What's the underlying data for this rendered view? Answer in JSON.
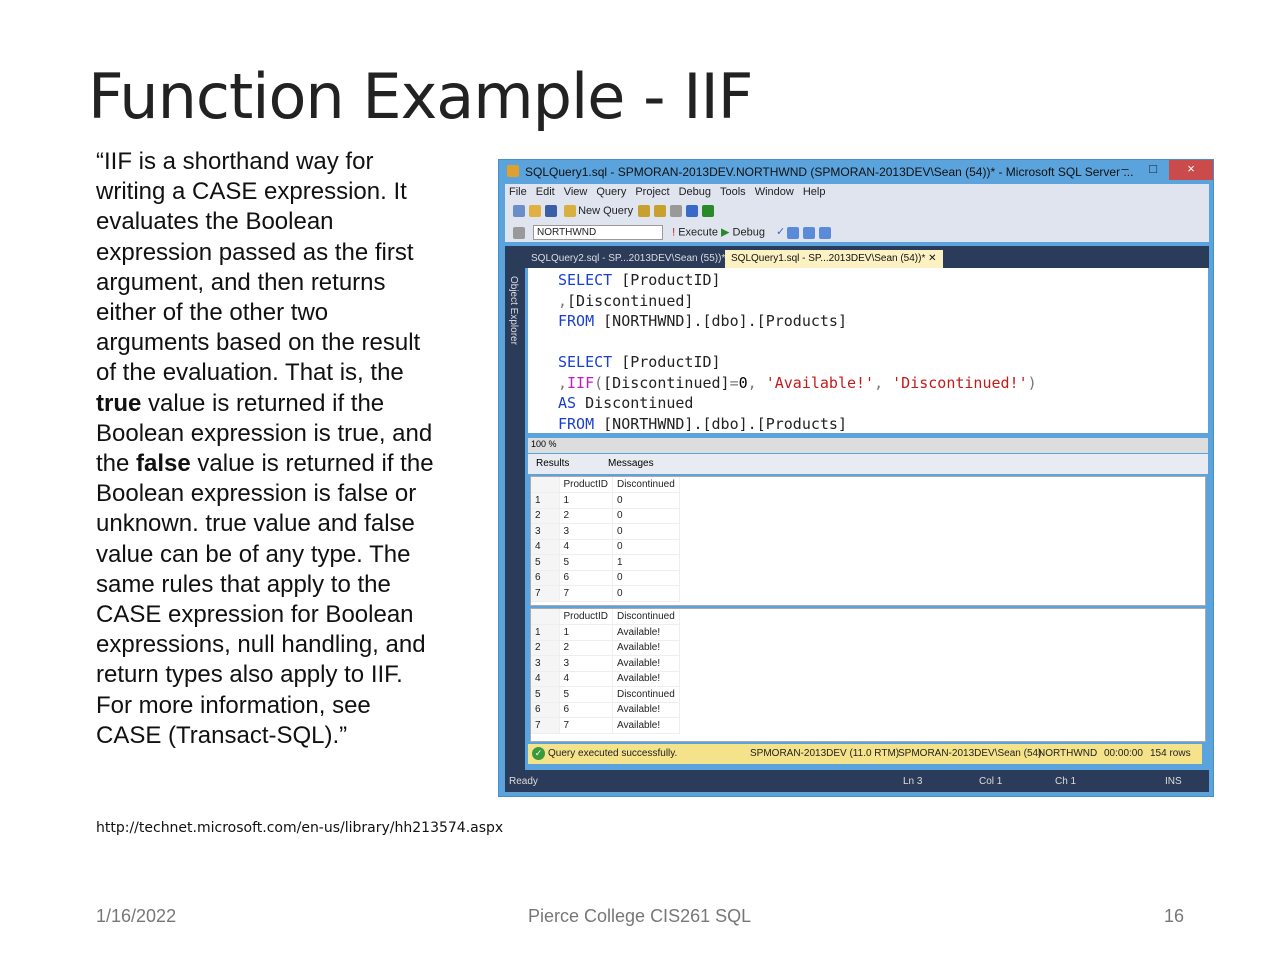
{
  "slide": {
    "title": "Function Example - IIF",
    "body_parts": [
      "“IIF is a shorthand way for writing a CASE expression. It evaluates the Boolean expression passed as the first argument, and then returns either of the other two arguments based on the result of the evaluation. That is, the ",
      "true",
      " value is returned if the Boolean expression is true, and the ",
      "false",
      " value is returned if the Boolean expression is false or unknown. true value and false value can be of any type. The same rules that apply to the CASE expression for Boolean expressions, null handling, and return types also apply to IIF. For more information, see CASE (Transact-SQL).”"
    ],
    "source": "http://technet.microsoft.com/en-us/library/hh213574.aspx",
    "date": "1/16/2022",
    "footer": "Pierce College CIS261 SQL",
    "page": "16"
  },
  "ssms": {
    "title": "SQLQuery1.sql - SPMORAN-2013DEV.NORTHWND (SPMORAN-2013DEV\\Sean (54))* - Microsoft SQL Server ...",
    "menu": [
      "File",
      "Edit",
      "View",
      "Query",
      "Project",
      "Debug",
      "Tools",
      "Window",
      "Help"
    ],
    "new_query": "New Query",
    "database": "NORTHWND",
    "execute": "Execute",
    "debug": "Debug",
    "object_explorer": "Object Explorer",
    "tabs": [
      "SQLQuery2.sql - SP...2013DEV\\Sean (55))*",
      "SQLQuery1.sql - SP...2013DEV\\Sean (54))*"
    ],
    "zoom": "100 %",
    "result_tabs": [
      "Results",
      "Messages"
    ],
    "grid1": {
      "headers": [
        "ProductID",
        "Discontinued"
      ],
      "rows": [
        [
          "1",
          "1",
          "0"
        ],
        [
          "2",
          "2",
          "0"
        ],
        [
          "3",
          "3",
          "0"
        ],
        [
          "4",
          "4",
          "0"
        ],
        [
          "5",
          "5",
          "1"
        ],
        [
          "6",
          "6",
          "0"
        ],
        [
          "7",
          "7",
          "0"
        ]
      ]
    },
    "grid2": {
      "headers": [
        "ProductID",
        "Discontinued"
      ],
      "rows": [
        [
          "1",
          "1",
          "Available!"
        ],
        [
          "2",
          "2",
          "Available!"
        ],
        [
          "3",
          "3",
          "Available!"
        ],
        [
          "4",
          "4",
          "Available!"
        ],
        [
          "5",
          "5",
          "Discontinued"
        ],
        [
          "6",
          "6",
          "Available!"
        ],
        [
          "7",
          "7",
          "Available!"
        ]
      ]
    },
    "status": {
      "message": "Query executed successfully.",
      "server": "SPMORAN-2013DEV (11.0 RTM)",
      "user": "SPMORAN-2013DEV\\Sean (54)",
      "db": "NORTHWND",
      "time": "00:00:00",
      "rows": "154 rows"
    },
    "bottom": {
      "ready": "Ready",
      "ln": "Ln 3",
      "col": "Col 1",
      "ch": "Ch 1",
      "ins": "INS"
    }
  }
}
